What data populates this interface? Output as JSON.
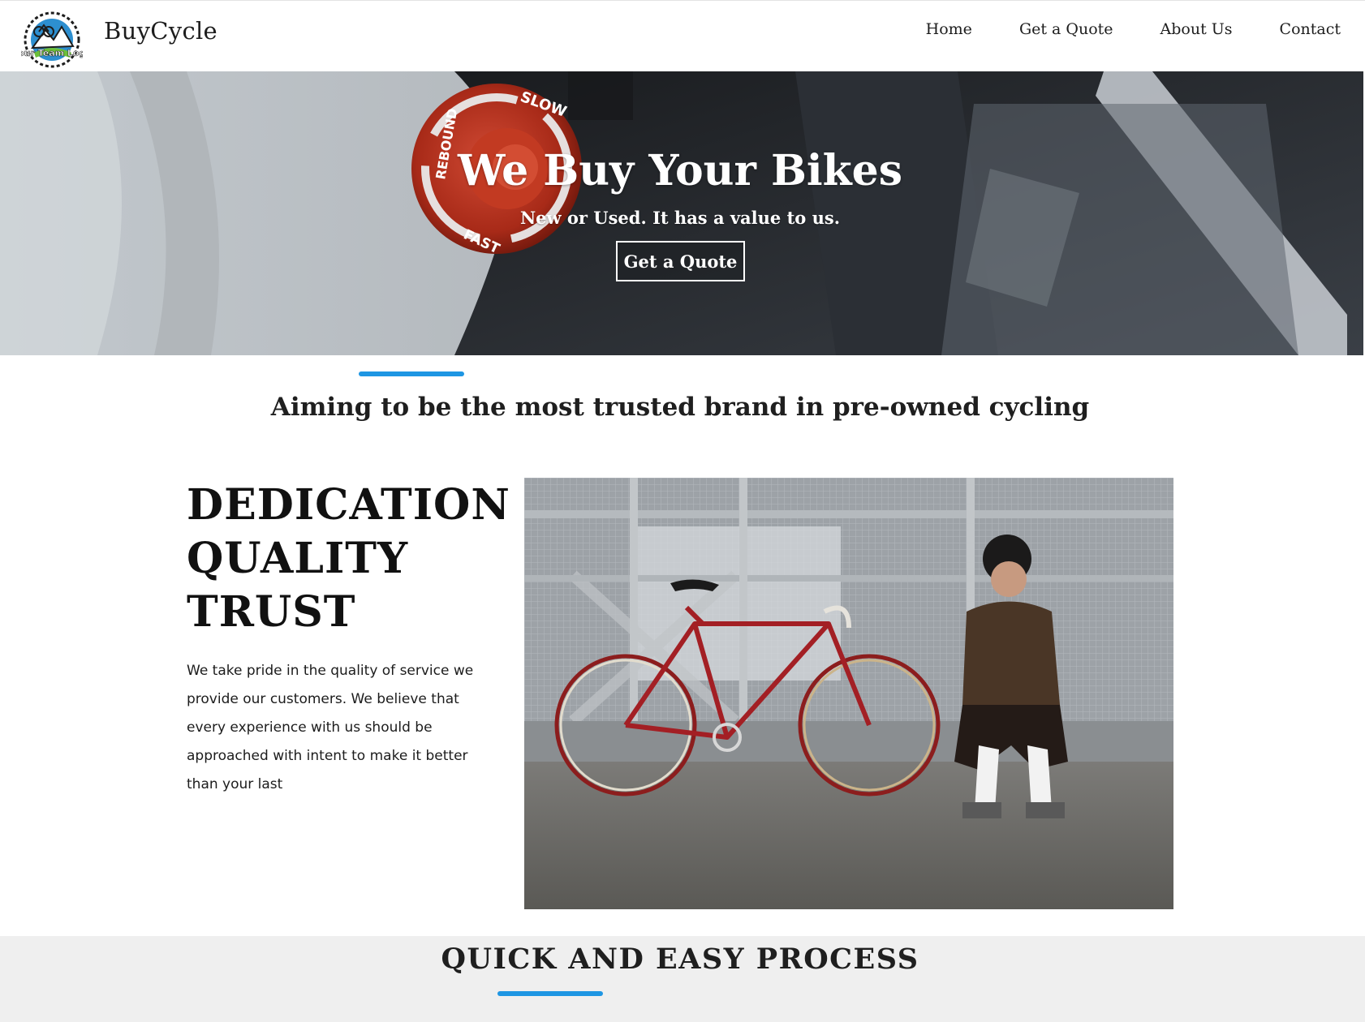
{
  "header": {
    "logo_text": "Your Team Logo",
    "brand": "BuyCycle",
    "nav": [
      {
        "label": "Home"
      },
      {
        "label": "Get a Quote"
      },
      {
        "label": "About Us"
      },
      {
        "label": "Contact"
      }
    ]
  },
  "hero": {
    "title": "We Buy Your Bikes",
    "subtitle": "New or Used. It has a value to us.",
    "cta_label": "Get a Quote",
    "dial_labels": {
      "top": "SLOW",
      "left": "REBOUND",
      "bottom": "FAST"
    }
  },
  "tagline": "Aiming to be the most trusted brand in pre-owned cycling",
  "values": {
    "headings": [
      "DEDICATION",
      "QUALITY",
      "TRUST"
    ],
    "description": "We take pride in the quality of service we provide our customers. We believe that every experience with us should be approached with intent to make it better than your last"
  },
  "process": {
    "title": "QUICK AND EASY PROCESS"
  },
  "colors": {
    "accent": "#1e96e3",
    "hero_knob": "#b8321f",
    "process_band": "#efefef"
  }
}
